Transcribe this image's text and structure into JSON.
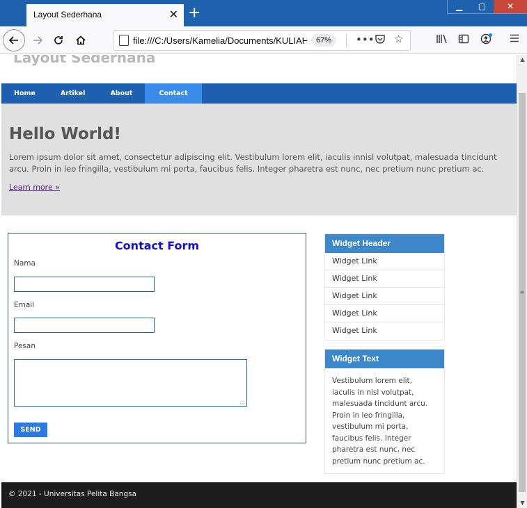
{
  "browser": {
    "tab_title": "Layout Sederhana",
    "tab_close_glyph": "✕",
    "new_tab_glyph": "+",
    "url": "file:///C:/Users/Kamelia/Documents/KULIAH",
    "zoom": "67%",
    "window_controls": {
      "minimize": "▁",
      "maximize": "▢",
      "close": "✕"
    },
    "icons": {
      "back": "back-arrow-icon",
      "forward": "forward-arrow-icon",
      "reload": "reload-icon",
      "home": "home-icon",
      "page_actions": "more-icon",
      "pocket": "pocket-icon",
      "bookmark": "star-icon",
      "library": "library-icon",
      "sidebar": "sidebar-icon",
      "account": "account-icon",
      "menu": "hamburger-menu-icon"
    }
  },
  "page": {
    "site_title": "Layout Sederhana",
    "menu": [
      {
        "label": "Home",
        "active": false
      },
      {
        "label": "Artikel",
        "active": false
      },
      {
        "label": "About",
        "active": false
      },
      {
        "label": "Contact",
        "active": true
      }
    ],
    "hero": {
      "heading": "Hello World!",
      "paragraph": "Lorem ipsum dolor sit amet, consectetur adipiscing elit. Vestibulum lorem elit, iaculis innisl volutpat, malesuada tincidunt arcu. Proin in leo fringilla, vestibulum mi porta, faucibus felis. Integer pharetra est nunc, nec pretium nunc pretium ac.",
      "link": "Learn more »"
    },
    "contact_form": {
      "title": "Contact Form",
      "fields": [
        {
          "label": "Nama",
          "value": ""
        },
        {
          "label": "Email",
          "value": ""
        },
        {
          "label": "Pesan",
          "value": ""
        }
      ],
      "submit_label": "SEND"
    },
    "widget_links": {
      "header": "Widget Header",
      "links": [
        "Widget Link",
        "Widget Link",
        "Widget Link",
        "Widget Link",
        "Widget Link"
      ]
    },
    "widget_text": {
      "header": "Widget Text",
      "body": "Vestibulum lorem elit, iaculis in nisl volutpat, malesuada tincidunt arcu. Proin in leo fringilla, vestibulum mi porta, faucibus felis. Integer pharetra est nunc, nec pretium nunc pretium ac."
    },
    "footer": "© 2021 - Universitas Pelita Bangsa"
  },
  "colors": {
    "titlebar": "#1e62ad",
    "menu_bg": "#1f5fb0",
    "menu_active": "#3b8beb",
    "widget_header": "#3d87cb",
    "form_title": "#1010d8",
    "send_button": "#2a7ae2",
    "footer_bg": "#1d1d1d"
  }
}
